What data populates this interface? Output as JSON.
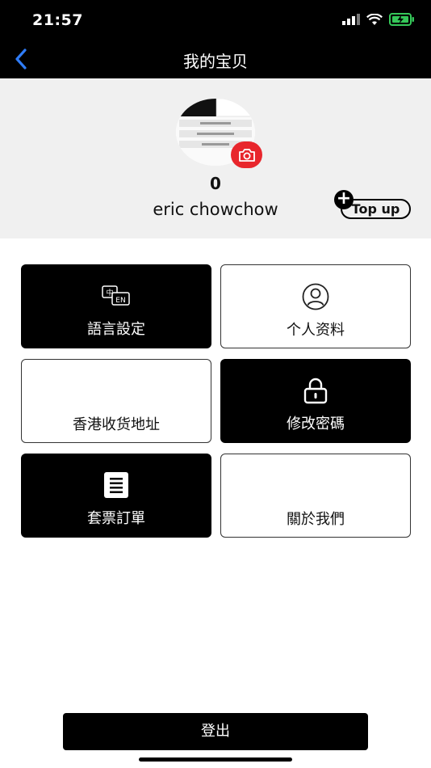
{
  "status_bar": {
    "time": "21:57"
  },
  "nav": {
    "title": "我的宝贝"
  },
  "profile": {
    "balance": "0",
    "username": "eric chowchow",
    "topup_label": "Top up"
  },
  "menu": {
    "tiles": [
      {
        "label": "語言設定",
        "icon": "language-icon",
        "style": "dark",
        "icon_text": "中EN"
      },
      {
        "label": "个人资料",
        "icon": "profile-icon",
        "style": "light"
      },
      {
        "label": "香港收货地址",
        "icon": "none",
        "style": "light"
      },
      {
        "label": "修改密碼",
        "icon": "lock-icon",
        "style": "dark"
      },
      {
        "label": "套票訂單",
        "icon": "order-list-icon",
        "style": "dark"
      },
      {
        "label": "關於我們",
        "icon": "none",
        "style": "light"
      }
    ]
  },
  "logout": {
    "label": "登出"
  },
  "colors": {
    "accent": "#e8262c",
    "back_arrow": "#2f7cf6",
    "battery": "#35c759"
  }
}
